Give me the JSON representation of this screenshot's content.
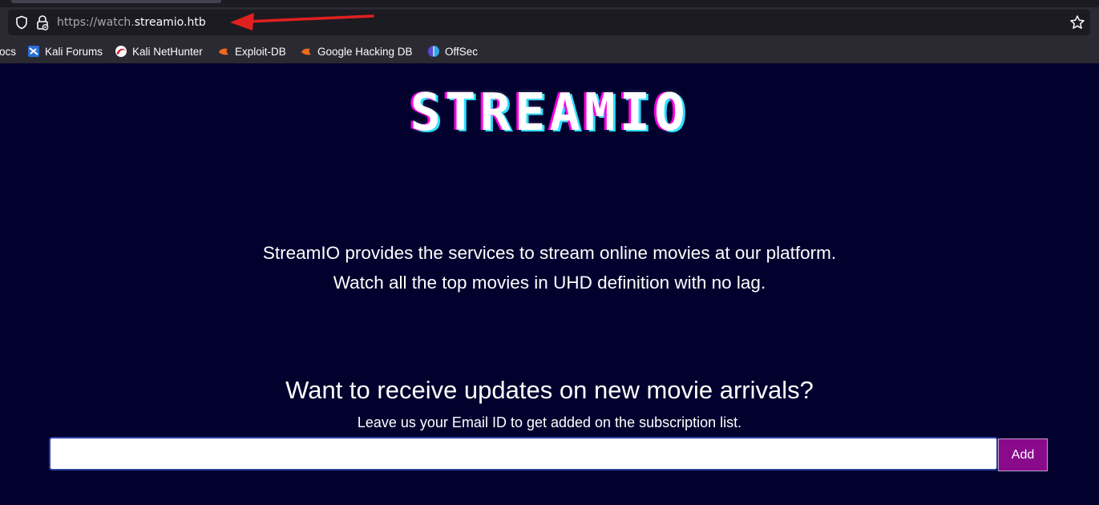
{
  "browser": {
    "url_scheme": "https://watch.",
    "url_host": "streamio.htb",
    "bookmarks": [
      {
        "label": "ocs",
        "icon": "none"
      },
      {
        "label": "Kali Forums",
        "icon": "kali-forums-icon"
      },
      {
        "label": "Kali NetHunter",
        "icon": "kali-nethunter-icon"
      },
      {
        "label": "Exploit-DB",
        "icon": "exploit-db-icon"
      },
      {
        "label": "Google Hacking DB",
        "icon": "exploit-db-icon"
      },
      {
        "label": "OffSec",
        "icon": "offsec-icon"
      }
    ]
  },
  "site": {
    "logo": "STREAMIO",
    "description_line1": "StreamIO provides the services to stream online movies at our platform.",
    "description_line2": "Watch all the top movies in UHD definition with no lag.",
    "subscribe_heading": "Want to receive updates on new movie arrivals?",
    "subscribe_note": "Leave us your Email ID to get added on the subscription list.",
    "email_value": "",
    "add_label": "Add"
  },
  "colors": {
    "page_bg": "#02012e",
    "button_bg": "#8a0a8c",
    "annotation_arrow": "#e02020"
  }
}
